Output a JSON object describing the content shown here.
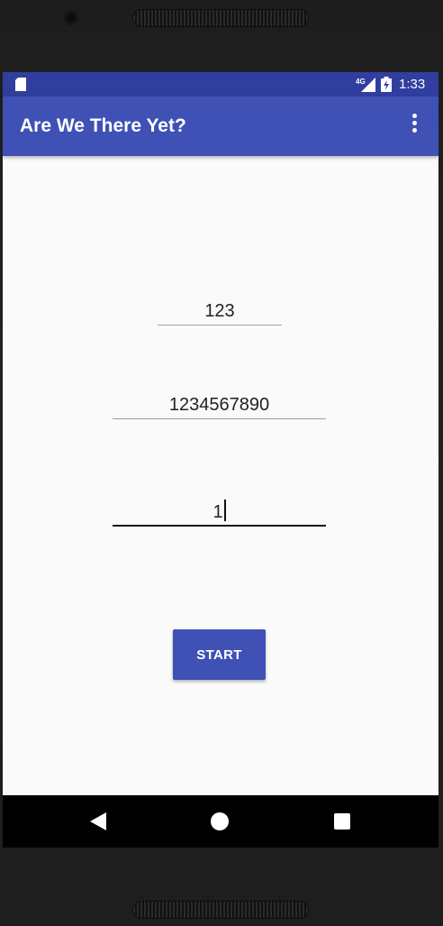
{
  "status_bar": {
    "time": "1:33",
    "network_label": "4G",
    "icons": [
      "sd-card-icon",
      "signal-4g-icon",
      "battery-charging-icon"
    ],
    "color": "#303f9f"
  },
  "app_bar": {
    "title": "Are We There Yet?",
    "menu_icon": "more-vert-icon",
    "color": "#3f51b5"
  },
  "form": {
    "field_1_value": "123",
    "field_2_value": "1234567890",
    "field_3_value": "1",
    "focused_field": 3
  },
  "start_button": {
    "label": "START",
    "color": "#3f51b5"
  },
  "nav_bar": {
    "icons": [
      "back-icon",
      "home-icon",
      "recents-icon"
    ]
  }
}
